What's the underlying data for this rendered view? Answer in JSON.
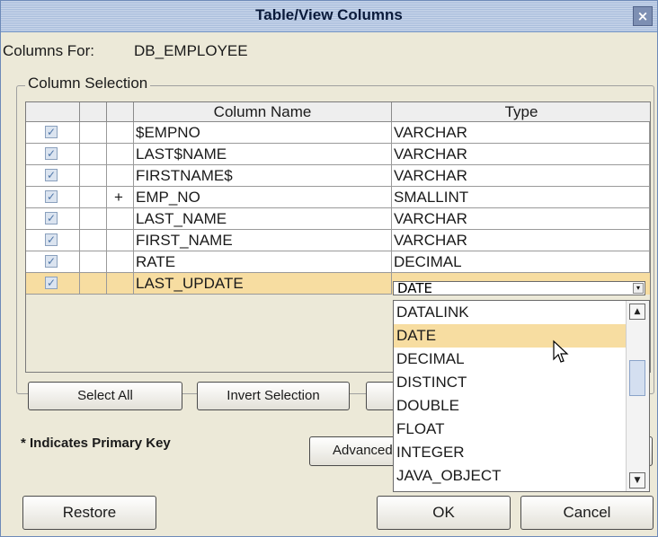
{
  "window": {
    "title": "Table/View Columns",
    "close_glyph": "×"
  },
  "columns_for": {
    "label": "Columns For:",
    "value": "DB_EMPLOYEE"
  },
  "group": {
    "label": "Column Selection"
  },
  "table": {
    "headers": [
      "",
      "",
      "",
      "Column Name",
      "Type"
    ],
    "rows": [
      {
        "checked": true,
        "pk": "",
        "name": "$EMPNO",
        "type": "VARCHAR",
        "selected": false
      },
      {
        "checked": true,
        "pk": "",
        "name": "LAST$NAME",
        "type": "VARCHAR",
        "selected": false
      },
      {
        "checked": true,
        "pk": "",
        "name": "FIRSTNAME$",
        "type": "VARCHAR",
        "selected": false
      },
      {
        "checked": true,
        "pk": "+",
        "name": "EMP_NO",
        "type": "SMALLINT",
        "selected": false
      },
      {
        "checked": true,
        "pk": "",
        "name": "LAST_NAME",
        "type": "VARCHAR",
        "selected": false
      },
      {
        "checked": true,
        "pk": "",
        "name": "FIRST_NAME",
        "type": "VARCHAR",
        "selected": false
      },
      {
        "checked": true,
        "pk": "",
        "name": "RATE",
        "type": "DECIMAL",
        "selected": false
      },
      {
        "checked": true,
        "pk": "",
        "name": "LAST_UPDATE",
        "type": "DATE",
        "selected": true
      }
    ]
  },
  "type_dropdown": {
    "current": "DATE",
    "options": [
      "DATALINK",
      "DATE",
      "DECIMAL",
      "DISTINCT",
      "DOUBLE",
      "FLOAT",
      "INTEGER",
      "JAVA_OBJECT"
    ],
    "highlighted": "DATE"
  },
  "buttons": {
    "select_all": "Select All",
    "invert_selection": "Invert Selection",
    "advanced": "Advanced",
    "restore": "Restore",
    "ok": "OK",
    "cancel": "Cancel"
  },
  "notes": {
    "primary_key": "* Indicates Primary Key"
  },
  "icons": {
    "close": "close-icon",
    "check": "checkbox-checked-icon",
    "scroll_up": "arrow-up-icon",
    "scroll_down": "arrow-down-icon",
    "combo": "chevron-down-icon",
    "cursor": "mouse-cursor-icon"
  },
  "colors": {
    "selection": "#f7dda1",
    "titlebar": "#b7c8e2"
  }
}
